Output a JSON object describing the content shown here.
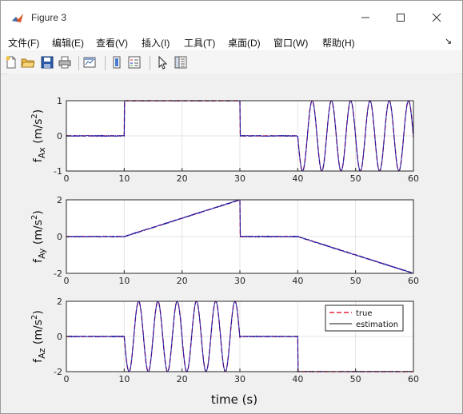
{
  "window": {
    "title": "Figure 3",
    "icons": [
      "matlab-icon",
      "minimize-icon",
      "maximize-icon",
      "close-icon"
    ]
  },
  "menubar": {
    "items": [
      "文件(F)",
      "编辑(E)",
      "查看(V)",
      "插入(I)",
      "工具(T)",
      "桌面(D)",
      "窗口(W)",
      "帮助(H)"
    ]
  },
  "toolbar": {
    "icons": [
      "new-figure-icon",
      "open-icon",
      "save-icon",
      "print-icon",
      "link-plot-icon",
      "insert-colorbar-icon",
      "insert-legend-icon",
      "edit-plot-icon",
      "property-inspector-icon"
    ]
  },
  "colors": {
    "true": "#e8203c",
    "estimation": "#1a1aa8"
  },
  "xlabel": "time (s)",
  "chart_data": [
    {
      "type": "line",
      "name": "subplot-ax",
      "ylabel": {
        "f": "f",
        "sub": "Ax",
        "unit": " (m/s",
        "sup": "2",
        "close": ")"
      },
      "xlim": [
        0,
        60
      ],
      "ylim": [
        -1,
        1
      ],
      "xticks": [
        0,
        10,
        20,
        30,
        40,
        50,
        60
      ],
      "yticks": [
        -1,
        0,
        1
      ],
      "grid": true,
      "segments": [
        {
          "from": 0,
          "to": 10,
          "kind": "const",
          "value": 0
        },
        {
          "from": 10,
          "to": 30,
          "kind": "const",
          "value": 1
        },
        {
          "from": 30,
          "to": 40,
          "kind": "const",
          "value": 0
        },
        {
          "from": 40,
          "to": 60,
          "kind": "sine",
          "amplitude": -1,
          "period": 3.33
        }
      ]
    },
    {
      "type": "line",
      "name": "subplot-ay",
      "ylabel": {
        "f": "f",
        "sub": "Ay",
        "unit": " (m/s",
        "sup": "2",
        "close": ")"
      },
      "xlim": [
        0,
        60
      ],
      "ylim": [
        -2,
        2
      ],
      "xticks": [
        0,
        10,
        20,
        30,
        40,
        50,
        60
      ],
      "yticks": [
        -2,
        0,
        2
      ],
      "grid": true,
      "segments": [
        {
          "from": 0,
          "to": 10,
          "kind": "const",
          "value": 0
        },
        {
          "from": 10,
          "to": 30,
          "kind": "ramp",
          "start": 0,
          "end": 2
        },
        {
          "from": 30,
          "to": 40,
          "kind": "const",
          "value": 0
        },
        {
          "from": 40,
          "to": 60,
          "kind": "ramp",
          "start": 0,
          "end": -2
        }
      ]
    },
    {
      "type": "line",
      "name": "subplot-az",
      "ylabel": {
        "f": "f",
        "sub": "Az",
        "unit": " (m/s",
        "sup": "2",
        "close": ")"
      },
      "xlim": [
        0,
        60
      ],
      "ylim": [
        -2,
        2
      ],
      "xticks": [
        0,
        10,
        20,
        30,
        40,
        50,
        60
      ],
      "yticks": [
        -2,
        0,
        2
      ],
      "grid": true,
      "legend": {
        "position": "top-right",
        "entries": [
          "true",
          "estimation"
        ]
      },
      "segments": [
        {
          "from": 0,
          "to": 10,
          "kind": "const",
          "value": 0
        },
        {
          "from": 10,
          "to": 30,
          "kind": "sine",
          "amplitude": -2,
          "period": 3.33
        },
        {
          "from": 30,
          "to": 40,
          "kind": "const",
          "value": 0
        },
        {
          "from": 40,
          "to": 60,
          "kind": "const",
          "value": -2
        }
      ]
    }
  ]
}
